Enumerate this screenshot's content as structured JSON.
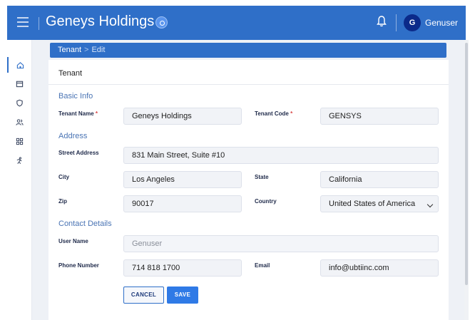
{
  "header": {
    "app_title": "Geneys Holdings",
    "user_initial": "G",
    "username": "Genuser"
  },
  "breadcrumb": {
    "parent": "Tenant",
    "separator": ">",
    "current": "Edit"
  },
  "sidebar": {
    "items": [
      {
        "icon": "home-icon",
        "active": true
      },
      {
        "icon": "box-icon",
        "active": false
      },
      {
        "icon": "shield-icon",
        "active": false
      },
      {
        "icon": "users-icon",
        "active": false
      },
      {
        "icon": "grid-icon",
        "active": false
      },
      {
        "icon": "person-running-icon",
        "active": false
      }
    ]
  },
  "form": {
    "card_title": "Tenant",
    "sections": {
      "basic_info": "Basic Info",
      "address": "Address",
      "contact": "Contact Details"
    },
    "tenant_name": {
      "label": "Tenant Name",
      "required": "*",
      "value": "Geneys Holdings"
    },
    "tenant_code": {
      "label": "Tenant Code",
      "required": "*",
      "value": "GENSYS"
    },
    "street_address": {
      "label": "Street Address",
      "value": "831 Main Street, Suite #10"
    },
    "city": {
      "label": "City",
      "value": "Los Angeles"
    },
    "state": {
      "label": "State",
      "value": "California"
    },
    "zip": {
      "label": "Zip",
      "value": "90017"
    },
    "country": {
      "label": "Country",
      "value": "United States of America"
    },
    "user_name": {
      "label": "User Name",
      "value": "Genuser"
    },
    "phone": {
      "label": "Phone Number",
      "value": "714 818 1700"
    },
    "email": {
      "label": "Email",
      "value": "info@ubtiinc.com"
    },
    "cancel_label": "CANCEL",
    "save_label": "SAVE"
  },
  "colors": {
    "header_bg": "#2f6fc8",
    "section_text": "#4a74b4",
    "avatar_bg": "#0b2a8a",
    "save_bg": "#2f7ae6"
  }
}
